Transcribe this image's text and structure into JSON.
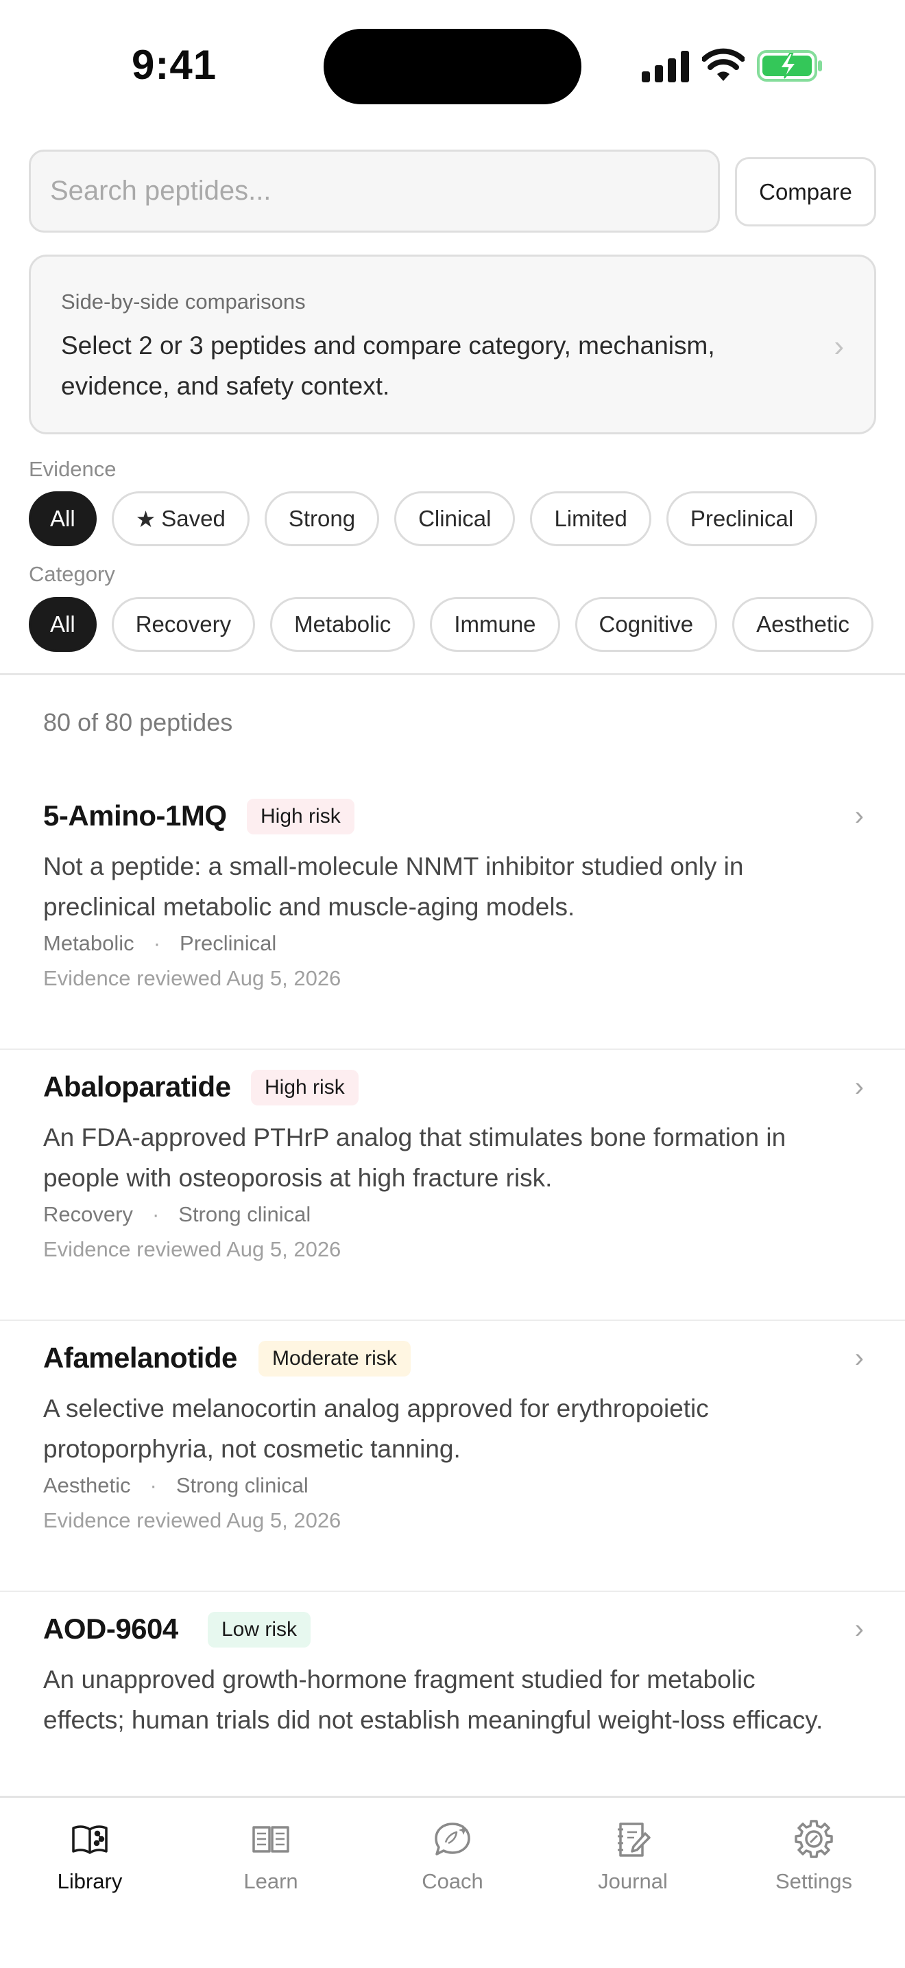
{
  "status_bar": {
    "time": "9:41"
  },
  "search": {
    "placeholder": "Search peptides...",
    "value": ""
  },
  "compare_button": {
    "label": "Compare"
  },
  "comparisons_card": {
    "kicker": "Side-by-side comparisons",
    "description": "Select 2 or 3 peptides and compare category, mechanism, evidence, and safety context."
  },
  "evidence_filter": {
    "label": "Evidence",
    "chips": [
      "All",
      "Saved",
      "Strong",
      "Clinical",
      "Limited",
      "Preclinical"
    ],
    "selected": "All"
  },
  "category_filter": {
    "label": "Category",
    "chips": [
      "All",
      "Recovery",
      "Metabolic",
      "Immune",
      "Cognitive",
      "Aesthetic"
    ],
    "selected": "All"
  },
  "results_count": "80 of 80 peptides",
  "peptides": [
    {
      "name": "5-Amino-1MQ",
      "risk": "High risk",
      "risk_level": "high",
      "summary": "Not a peptide: a small-molecule NNMT inhibitor studied only in preclinical metabolic and muscle-aging models.",
      "category": "Metabolic",
      "evidence": "Preclinical",
      "reviewed": "Evidence reviewed Aug 5, 2026"
    },
    {
      "name": "Abaloparatide",
      "risk": "High risk",
      "risk_level": "high",
      "summary": "An FDA-approved PTHrP analog that stimulates bone formation in people with osteoporosis at high fracture risk.",
      "category": "Recovery",
      "evidence": "Strong clinical",
      "reviewed": "Evidence reviewed Aug 5, 2026"
    },
    {
      "name": "Afamelanotide",
      "risk": "Moderate risk",
      "risk_level": "moderate",
      "summary": "A selective melanocortin analog approved for erythropoietic protoporphyria, not cosmetic tanning.",
      "category": "Aesthetic",
      "evidence": "Strong clinical",
      "reviewed": "Evidence reviewed Aug 5, 2026"
    },
    {
      "name": "AOD-9604",
      "risk": "Low risk",
      "risk_level": "low",
      "summary": "An unapproved growth-hormone fragment studied for metabolic effects; human trials did not establish meaningful weight-loss efficacy.",
      "category": "",
      "evidence": "",
      "reviewed": ""
    }
  ],
  "tabbar": {
    "tabs": [
      {
        "label": "Library",
        "icon": "book-open-icon",
        "active": true
      },
      {
        "label": "Learn",
        "icon": "open-book-icon",
        "active": false
      },
      {
        "label": "Coach",
        "icon": "coach-chat-icon",
        "active": false
      },
      {
        "label": "Journal",
        "icon": "journal-icon",
        "active": false
      },
      {
        "label": "Settings",
        "icon": "gear-icon",
        "active": false
      }
    ]
  },
  "colors": {
    "chip_active_bg": "#1b1b1b",
    "high_risk_bg": "#fdeef0",
    "moderate_risk_bg": "#fff6e2",
    "low_risk_bg": "#e7f8ef",
    "battery_green": "#34c759"
  }
}
